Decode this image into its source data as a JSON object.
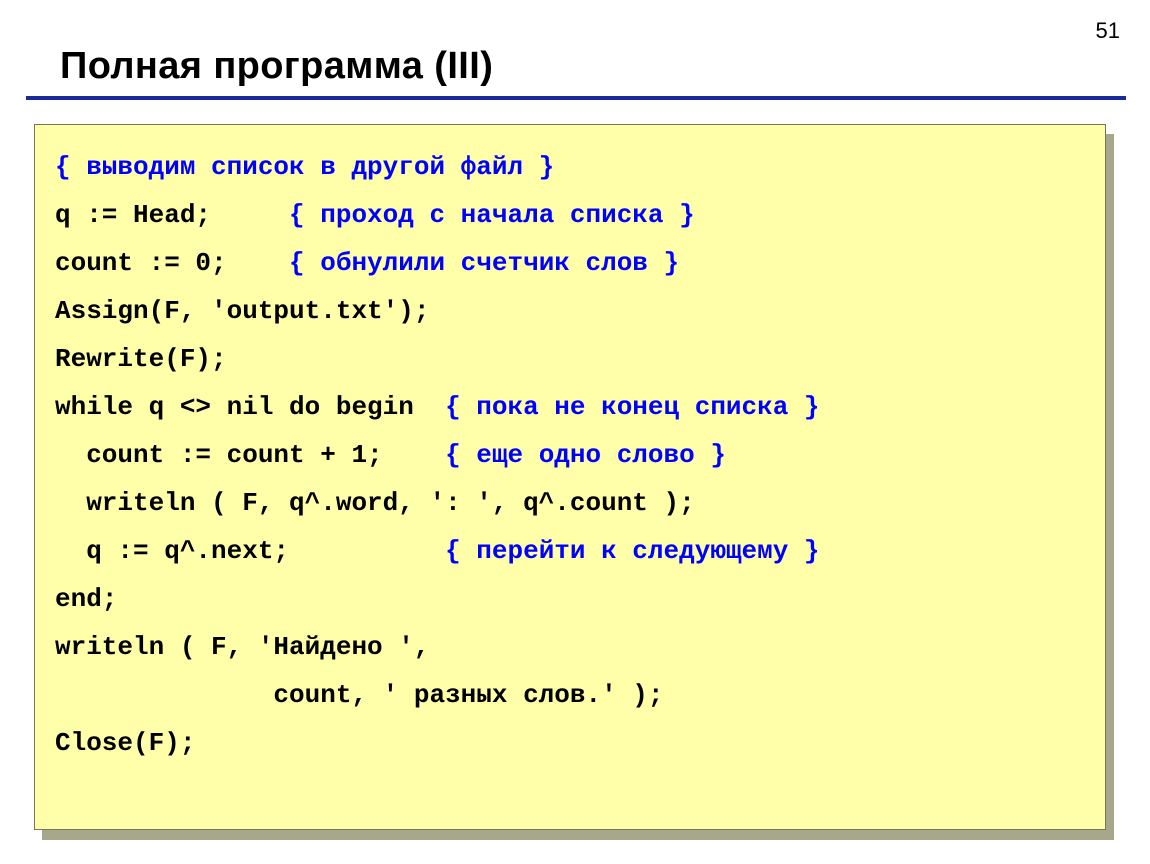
{
  "page_number": "51",
  "title": "Полная программа (III)",
  "lines": [
    {
      "seg": [
        {
          "t": "{ выводим список в другой файл }",
          "c": "cmt"
        }
      ]
    },
    {
      "seg": [
        {
          "t": "q := Head;     "
        },
        {
          "t": "{ проход с начала списка }",
          "c": "cmt"
        }
      ]
    },
    {
      "seg": [
        {
          "t": "count := 0;    "
        },
        {
          "t": "{ обнулили счетчик слов }",
          "c": "cmt"
        }
      ]
    },
    {
      "seg": [
        {
          "t": "Assign(F, 'output.txt');"
        }
      ]
    },
    {
      "seg": [
        {
          "t": "Rewrite(F);"
        }
      ]
    },
    {
      "seg": [
        {
          "t": "while q <> nil do begin  "
        },
        {
          "t": "{ пока не конец списка }",
          "c": "cmt"
        }
      ]
    },
    {
      "seg": [
        {
          "t": "  count := count + 1;    "
        },
        {
          "t": "{ еще одно слово }",
          "c": "cmt"
        }
      ]
    },
    {
      "seg": [
        {
          "t": "  writeln ( F, q^.word, ': ', q^.count );"
        }
      ]
    },
    {
      "seg": [
        {
          "t": "  q := q^.next;          "
        },
        {
          "t": "{ перейти к следующему }",
          "c": "cmt"
        }
      ]
    },
    {
      "seg": [
        {
          "t": "end;"
        }
      ]
    },
    {
      "seg": [
        {
          "t": "writeln ( F, 'Найдено ',"
        }
      ]
    },
    {
      "seg": [
        {
          "t": "              count, ' разных слов.' );"
        }
      ]
    },
    {
      "seg": [
        {
          "t": "Close(F);"
        }
      ]
    }
  ]
}
